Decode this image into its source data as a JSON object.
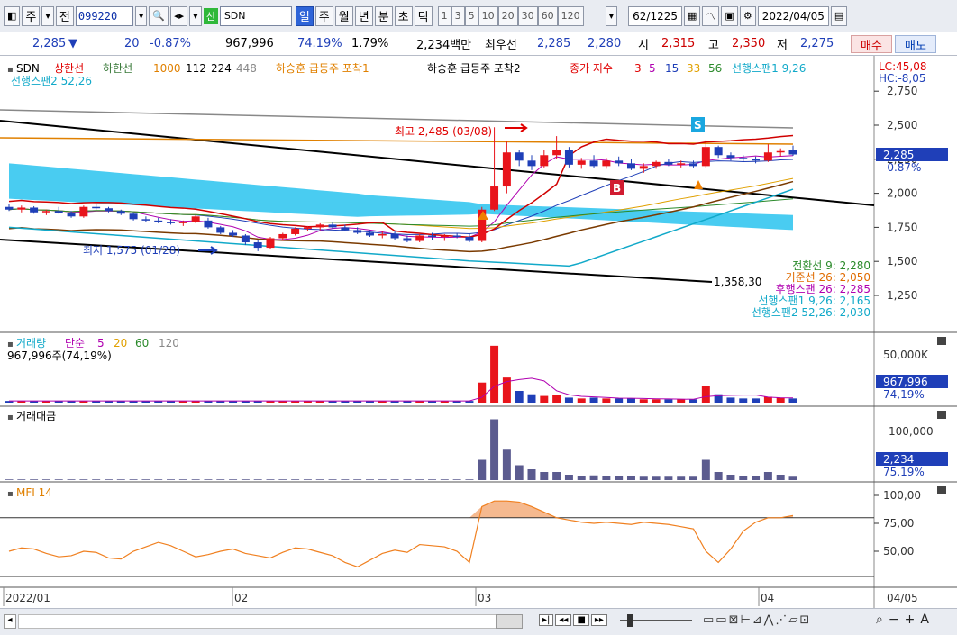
{
  "toolbar": {
    "period_daily": "주",
    "prev_label": "전",
    "stock_code": "099220",
    "sin_label": "신",
    "stock_name": "SDN",
    "period_tabs": [
      "일",
      "주",
      "월",
      "년",
      "분",
      "초",
      "틱"
    ],
    "minute_options": [
      "1",
      "3",
      "5",
      "10",
      "20",
      "30",
      "60",
      "120"
    ],
    "count_display": "62",
    "count_total": "/1225",
    "date": "2022/04/05"
  },
  "quote": {
    "price": "2,285",
    "arrow": "▼",
    "change": "20",
    "change_pct": "-0.87%",
    "volume": "967,996",
    "vol_ratio": "74.19%",
    "turnover": "1.79%",
    "amount": "2,234백만",
    "priority_label": "최우선",
    "ask": "2,285",
    "bid": "2,280",
    "open_label": "시",
    "open": "2,315",
    "high_label": "고",
    "high": "2,350",
    "low_label": "저",
    "low": "2,275",
    "buy_label": "매수",
    "sell_label": "매도"
  },
  "legend_main": {
    "name": "SDN",
    "upper": "상한선",
    "lower": "하한선",
    "ma_1000": "1000",
    "ma_112": "112",
    "ma_224": "224",
    "ma_448": "448",
    "cond1": "하승훈 급등주 포착1",
    "cond2": "하승훈 급등주 포착2",
    "ma_label": "종가 지수",
    "ma3": "3",
    "ma5": "5",
    "ma15": "15",
    "ma33": "33",
    "ma56": "56",
    "span1": "선행스팬1 9,26",
    "span2": "선행스팬2 52,26",
    "lc": "LC:45,08",
    "hc": "HC:-8,05"
  },
  "annotations": {
    "high_note": "최고 2,485 (03/08)",
    "low_note": "최저 1,575 (01/28)",
    "line_value": "1,358,30",
    "s_marker": "S",
    "b_marker": "B"
  },
  "ichimoku_values": [
    {
      "label": "전환선 9: 2,280",
      "color": "#2b8a2b"
    },
    {
      "label": "기준선 26: 2,050",
      "color": "#e06b00"
    },
    {
      "label": "후행스팬 26: 2,285",
      "color": "#b000b0"
    },
    {
      "label": "선행스팬1 9,26: 2,165",
      "color": "#11a9c9"
    },
    {
      "label": "선행스팬2 52,26: 2,030",
      "color": "#11a9c9"
    }
  ],
  "price_axis": {
    "ticks": [
      "2,750",
      "2,500",
      "2,250",
      "2,000",
      "1,750",
      "1,500",
      "1,250"
    ],
    "current": "2,285",
    "current_pct": "-0.87%"
  },
  "volume_panel": {
    "title": "거래량",
    "ma_label": "단순",
    "ma5": "5",
    "ma20": "20",
    "ma60": "60",
    "ma120": "120",
    "value_text": "967,996주(74,19%)",
    "axis_tick": "50,000K",
    "current": "967,996",
    "current_pct": "74,19%"
  },
  "amount_panel": {
    "title": "거래대금",
    "axis_tick": "100,000",
    "current": "2,234",
    "current_pct": "75,19%"
  },
  "mfi_panel": {
    "title": "MFI 14",
    "ticks": [
      "100,00",
      "75,00",
      "50,00"
    ]
  },
  "x_axis": {
    "labels": [
      "2022/01",
      "02",
      "03",
      "04"
    ],
    "right_label": "04/05"
  },
  "colors": {
    "up": "#e8141b",
    "down": "#1f3fb8",
    "cloud": "#35c7ef",
    "accent": "#2e64d8"
  },
  "chart_data": {
    "type": "candlestick",
    "categories_note": "",
    "candles": [
      {
        "o": 1900,
        "h": 1920,
        "l": 1870,
        "c": 1880
      },
      {
        "o": 1880,
        "h": 1910,
        "l": 1860,
        "c": 1895
      },
      {
        "o": 1895,
        "h": 1905,
        "l": 1850,
        "c": 1860
      },
      {
        "o": 1860,
        "h": 1880,
        "l": 1840,
        "c": 1870
      },
      {
        "o": 1870,
        "h": 1900,
        "l": 1850,
        "c": 1855
      },
      {
        "o": 1855,
        "h": 1870,
        "l": 1820,
        "c": 1830
      },
      {
        "o": 1830,
        "h": 1910,
        "l": 1820,
        "c": 1900
      },
      {
        "o": 1900,
        "h": 1920,
        "l": 1880,
        "c": 1890
      },
      {
        "o": 1890,
        "h": 1900,
        "l": 1860,
        "c": 1870
      },
      {
        "o": 1870,
        "h": 1880,
        "l": 1840,
        "c": 1850
      },
      {
        "o": 1850,
        "h": 1860,
        "l": 1800,
        "c": 1810
      },
      {
        "o": 1810,
        "h": 1830,
        "l": 1790,
        "c": 1800
      },
      {
        "o": 1800,
        "h": 1820,
        "l": 1780,
        "c": 1790
      },
      {
        "o": 1790,
        "h": 1810,
        "l": 1770,
        "c": 1780
      },
      {
        "o": 1780,
        "h": 1800,
        "l": 1760,
        "c": 1790
      },
      {
        "o": 1790,
        "h": 1840,
        "l": 1780,
        "c": 1830
      },
      {
        "o": 1800,
        "h": 1820,
        "l": 1740,
        "c": 1750
      },
      {
        "o": 1750,
        "h": 1760,
        "l": 1700,
        "c": 1710
      },
      {
        "o": 1710,
        "h": 1730,
        "l": 1680,
        "c": 1690
      },
      {
        "o": 1690,
        "h": 1700,
        "l": 1620,
        "c": 1640
      },
      {
        "o": 1640,
        "h": 1660,
        "l": 1575,
        "c": 1600
      },
      {
        "o": 1600,
        "h": 1680,
        "l": 1590,
        "c": 1670
      },
      {
        "o": 1670,
        "h": 1710,
        "l": 1650,
        "c": 1700
      },
      {
        "o": 1700,
        "h": 1750,
        "l": 1690,
        "c": 1740
      },
      {
        "o": 1740,
        "h": 1760,
        "l": 1720,
        "c": 1750
      },
      {
        "o": 1750,
        "h": 1780,
        "l": 1730,
        "c": 1770
      },
      {
        "o": 1770,
        "h": 1790,
        "l": 1740,
        "c": 1750
      },
      {
        "o": 1750,
        "h": 1770,
        "l": 1720,
        "c": 1730
      },
      {
        "o": 1730,
        "h": 1750,
        "l": 1700,
        "c": 1710
      },
      {
        "o": 1710,
        "h": 1730,
        "l": 1680,
        "c": 1690
      },
      {
        "o": 1690,
        "h": 1720,
        "l": 1670,
        "c": 1700
      },
      {
        "o": 1700,
        "h": 1720,
        "l": 1660,
        "c": 1670
      },
      {
        "o": 1670,
        "h": 1690,
        "l": 1640,
        "c": 1650
      },
      {
        "o": 1650,
        "h": 1700,
        "l": 1640,
        "c": 1690
      },
      {
        "o": 1690,
        "h": 1710,
        "l": 1660,
        "c": 1680
      },
      {
        "o": 1680,
        "h": 1700,
        "l": 1650,
        "c": 1690
      },
      {
        "o": 1690,
        "h": 1710,
        "l": 1670,
        "c": 1680
      },
      {
        "o": 1680,
        "h": 1700,
        "l": 1640,
        "c": 1650
      },
      {
        "o": 1650,
        "h": 1900,
        "l": 1640,
        "c": 1880
      },
      {
        "o": 1880,
        "h": 2485,
        "l": 1870,
        "c": 2050
      },
      {
        "o": 2050,
        "h": 2380,
        "l": 2000,
        "c": 2300
      },
      {
        "o": 2300,
        "h": 2320,
        "l": 2200,
        "c": 2240
      },
      {
        "o": 2240,
        "h": 2280,
        "l": 2170,
        "c": 2200
      },
      {
        "o": 2200,
        "h": 2320,
        "l": 2190,
        "c": 2280
      },
      {
        "o": 2280,
        "h": 2420,
        "l": 2250,
        "c": 2320
      },
      {
        "o": 2320,
        "h": 2340,
        "l": 2190,
        "c": 2210
      },
      {
        "o": 2210,
        "h": 2260,
        "l": 2180,
        "c": 2240
      },
      {
        "o": 2240,
        "h": 2280,
        "l": 2190,
        "c": 2200
      },
      {
        "o": 2200,
        "h": 2260,
        "l": 2180,
        "c": 2240
      },
      {
        "o": 2240,
        "h": 2270,
        "l": 2200,
        "c": 2220
      },
      {
        "o": 2220,
        "h": 2250,
        "l": 2170,
        "c": 2180
      },
      {
        "o": 2180,
        "h": 2220,
        "l": 2150,
        "c": 2200
      },
      {
        "o": 2200,
        "h": 2240,
        "l": 2180,
        "c": 2230
      },
      {
        "o": 2230,
        "h": 2250,
        "l": 2200,
        "c": 2210
      },
      {
        "o": 2210,
        "h": 2240,
        "l": 2190,
        "c": 2220
      },
      {
        "o": 2220,
        "h": 2240,
        "l": 2190,
        "c": 2200
      },
      {
        "o": 2200,
        "h": 2390,
        "l": 2190,
        "c": 2340
      },
      {
        "o": 2340,
        "h": 2350,
        "l": 2260,
        "c": 2280
      },
      {
        "o": 2280,
        "h": 2300,
        "l": 2240,
        "c": 2260
      },
      {
        "o": 2260,
        "h": 2280,
        "l": 2230,
        "c": 2250
      },
      {
        "o": 2250,
        "h": 2270,
        "l": 2220,
        "c": 2240
      },
      {
        "o": 2240,
        "h": 2360,
        "l": 2230,
        "c": 2300
      },
      {
        "o": 2300,
        "h": 2330,
        "l": 2270,
        "c": 2310
      },
      {
        "o": 2315,
        "h": 2350,
        "l": 2275,
        "c": 2285
      }
    ],
    "volumes": [
      2,
      2,
      2,
      2,
      2,
      2,
      2,
      2,
      2,
      2,
      2,
      2,
      2,
      2,
      2,
      2,
      2,
      2,
      2,
      2,
      2,
      2,
      2,
      2,
      2,
      2,
      2,
      2,
      2,
      2,
      2,
      2,
      2,
      2,
      2,
      2,
      2,
      2,
      24,
      68,
      30,
      14,
      10,
      8,
      9,
      6,
      5,
      6,
      5,
      5,
      5,
      4,
      4,
      4,
      4,
      4,
      20,
      10,
      6,
      5,
      5,
      7,
      6,
      5
    ],
    "amounts": [
      1,
      1,
      1,
      1,
      1,
      1,
      1,
      1,
      1,
      1,
      1,
      1,
      1,
      1,
      1,
      1,
      1,
      1,
      1,
      1,
      1,
      1,
      1,
      1,
      1,
      1,
      1,
      1,
      1,
      1,
      1,
      1,
      1,
      1,
      1,
      1,
      1,
      1,
      30,
      90,
      45,
      22,
      16,
      12,
      12,
      8,
      6,
      7,
      6,
      6,
      6,
      5,
      5,
      5,
      5,
      5,
      30,
      12,
      8,
      6,
      6,
      12,
      8,
      5
    ],
    "mfi": [
      50,
      53,
      52,
      48,
      45,
      46,
      50,
      49,
      44,
      43,
      50,
      54,
      58,
      55,
      50,
      45,
      47,
      50,
      52,
      48,
      46,
      44,
      49,
      53,
      52,
      49,
      46,
      40,
      36,
      42,
      48,
      51,
      49,
      56,
      55,
      54,
      50,
      40,
      90,
      95,
      95,
      94,
      90,
      85,
      80,
      78,
      76,
      75,
      76,
      75,
      74,
      76,
      75,
      74,
      72,
      70,
      50,
      40,
      52,
      68,
      76,
      80,
      80,
      82
    ]
  }
}
